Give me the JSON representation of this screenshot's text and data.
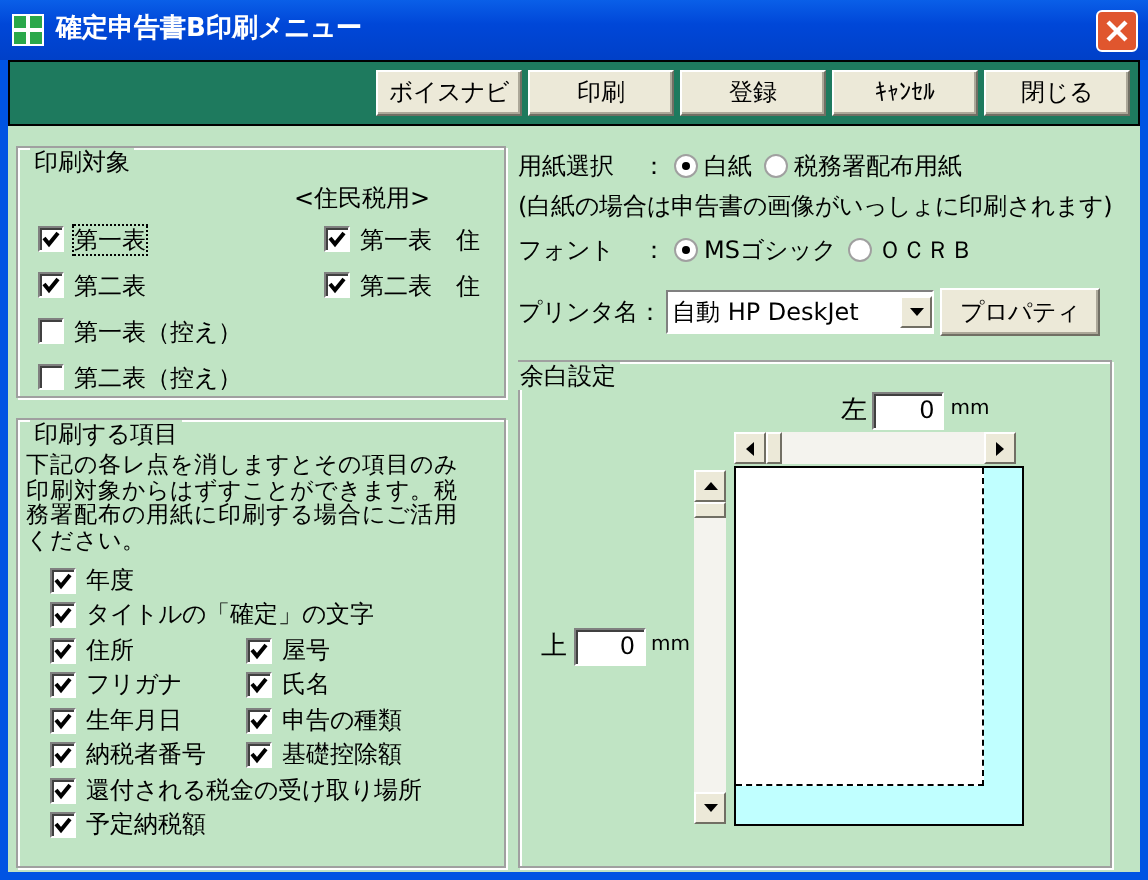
{
  "window": {
    "title": "確定申告書B印刷メニュー"
  },
  "toolbar": {
    "buttons": [
      "ボイスナビ",
      "印刷",
      "登録",
      "ｷｬﾝｾﾙ",
      "閉じる"
    ]
  },
  "print_target": {
    "title": "印刷対象",
    "resident_heading": "<住民税用>",
    "items": [
      {
        "label": "第一表",
        "checked": true,
        "focused": true
      },
      {
        "label": "第二表",
        "checked": true,
        "focused": false
      },
      {
        "label": "第一表（控え）",
        "checked": false,
        "focused": false
      },
      {
        "label": "第二表（控え）",
        "checked": false,
        "focused": false
      }
    ],
    "resident_items": [
      {
        "label": "第一表　住",
        "checked": true,
        "focused": false
      },
      {
        "label": "第二表　住",
        "checked": true,
        "focused": false
      }
    ]
  },
  "print_items": {
    "title": "印刷する項目",
    "description": "下記の各レ点を消しますとその項目のみ印刷対象からはずすことができます。税務署配布の用紙に印刷する場合にご活用ください。",
    "rows": [
      [
        {
          "label": "年度",
          "checked": true
        }
      ],
      [
        {
          "label": "タイトルの「確定」の文字",
          "checked": true
        }
      ],
      [
        {
          "label": "住所",
          "checked": true
        },
        {
          "label": "屋号",
          "checked": true
        }
      ],
      [
        {
          "label": "フリガナ",
          "checked": true
        },
        {
          "label": "氏名",
          "checked": true
        }
      ],
      [
        {
          "label": "生年月日",
          "checked": true
        },
        {
          "label": "申告の種類",
          "checked": true
        }
      ],
      [
        {
          "label": "納税者番号",
          "checked": true
        },
        {
          "label": "基礎控除額",
          "checked": true
        }
      ],
      [
        {
          "label": "還付される税金の受け取り場所",
          "checked": true
        }
      ],
      [
        {
          "label": "予定納税額",
          "checked": true
        }
      ]
    ]
  },
  "paper": {
    "label": "用紙選択",
    "separator": "：",
    "options": [
      {
        "label": "白紙",
        "selected": true
      },
      {
        "label": "税務署配布用紙",
        "selected": false
      }
    ],
    "note": "(白紙の場合は申告書の画像がいっしょに印刷されます)"
  },
  "font": {
    "label": "フォント",
    "separator": "：",
    "options": [
      {
        "label": "MSゴシック",
        "selected": true
      },
      {
        "label": "ＯＣＲＢ",
        "selected": false
      }
    ]
  },
  "printer": {
    "label": "プリンタ名：",
    "value": "自動 HP DeskJet",
    "button": "プロパティ"
  },
  "margins": {
    "title": "余白設定",
    "left": {
      "label": "左",
      "value": "0",
      "unit": "mm"
    },
    "top": {
      "label": "上",
      "value": "0",
      "unit": "mm"
    }
  }
}
